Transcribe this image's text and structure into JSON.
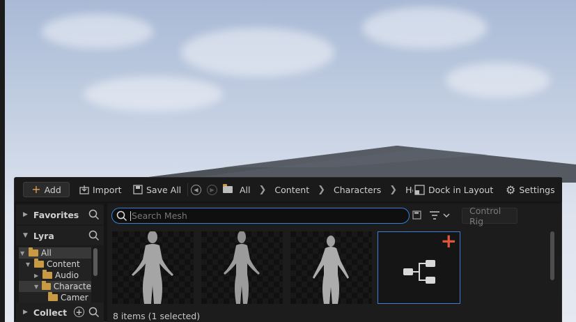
{
  "toolbar": {
    "add_label": "Add",
    "import_label": "Import",
    "save_all_label": "Save All",
    "breadcrumbs": [
      "All",
      "Content",
      "Characters",
      "He"
    ],
    "dock_label": "Dock in Layout",
    "settings_label": "Settings"
  },
  "sources": {
    "favorites_label": "Favorites",
    "project_label": "Lyra",
    "collections_label": "Collect",
    "tree": [
      "All",
      "Content",
      "Audio",
      "Characte",
      "Camer"
    ]
  },
  "assets": {
    "search_placeholder": "Search Mesh",
    "control_rig_label": "Control Rig",
    "status_text": "8 items (1 selected)"
  },
  "colors": {
    "accent": "#3b7fd3",
    "add_plus": "#e8a24a",
    "folder": "#c99a44",
    "new_badge": "#e2553d"
  }
}
